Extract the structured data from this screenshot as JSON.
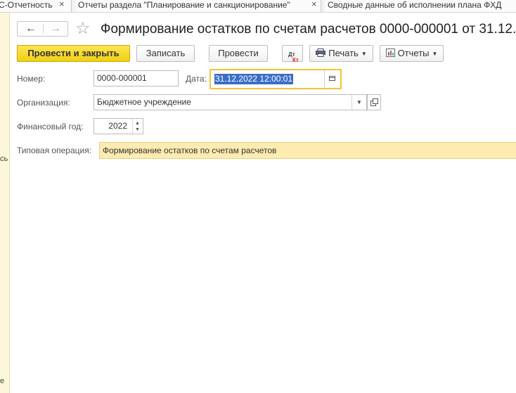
{
  "tabs": [
    {
      "label": "С-Отчетность",
      "close": "×"
    },
    {
      "label": "Отчеты раздела \"Планирование и санкционирование\"",
      "close": "×"
    },
    {
      "label": "Сводные данные об исполнении плана ФХД",
      "close": ""
    }
  ],
  "left_strip": {
    "frag1": "сь",
    "frag2": "е"
  },
  "header": {
    "back_icon": "arrow-left",
    "forward_icon": "arrow-right",
    "favorite_icon": "star",
    "title": "Формирование остатков по счетам расчетов 0000-000001 от 31.12."
  },
  "toolbar": {
    "post_close_label": "Провести и закрыть",
    "save_label": "Записать",
    "post_label": "Провести",
    "dtkt_dt": "Дт",
    "dtkt_kt": "Кт",
    "print_label": "Печать",
    "reports_label": "Отчеты"
  },
  "form": {
    "number_label": "Номер:",
    "number_value": "0000-000001",
    "date_label": "Дата:",
    "date_value": "31.12.2022 12:00:01",
    "org_label": "Организация:",
    "org_value": "Бюджетное учреждение",
    "year_label": "Финансовый год:",
    "year_value": "2022",
    "typical_label": "Типовая операция:",
    "typical_value": "Формирование остатков по счетам расчетов"
  },
  "colors": {
    "primary_button": "#f3d317",
    "date_focus_border": "#f2c437",
    "selection": "#3a6ec8",
    "typical_bg": "#fdebb0"
  }
}
